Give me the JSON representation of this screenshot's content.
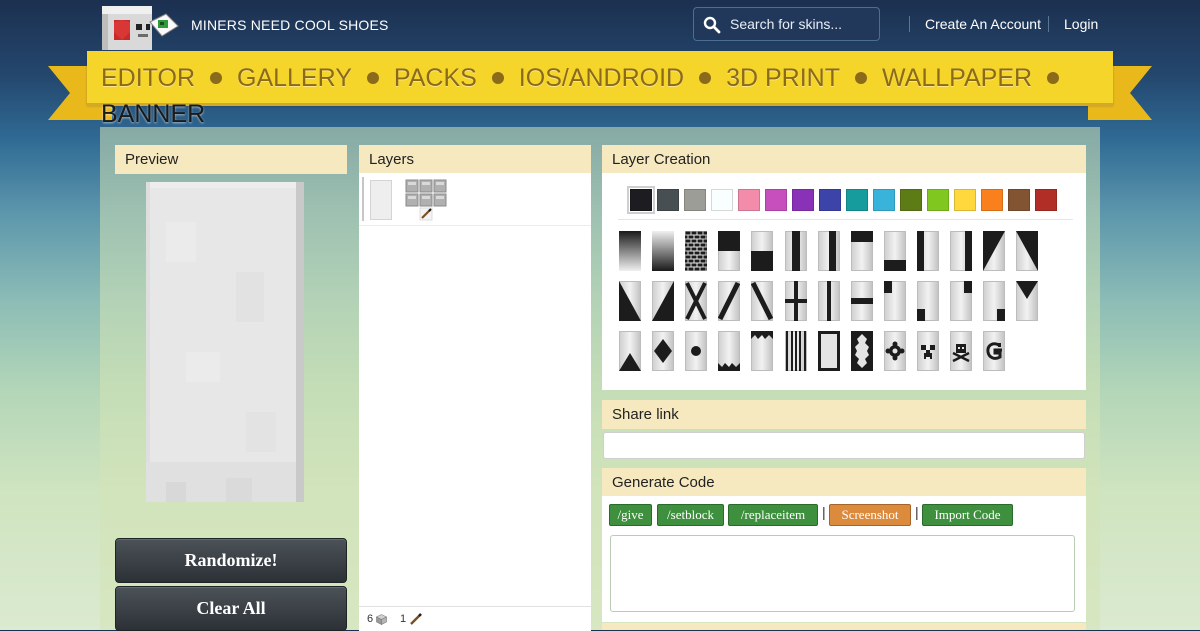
{
  "header": {
    "site_name": "MINERS NEED COOL SHOES",
    "search": {
      "placeholder": "Search for skins..."
    },
    "links": {
      "create_account": "Create An Account",
      "login": "Login"
    }
  },
  "nav": {
    "items": [
      "EDITOR",
      "GALLERY",
      "PACKS",
      "IOS/ANDROID",
      "3D PRINT",
      "WALLPAPER",
      "BANNER"
    ]
  },
  "preview": {
    "title": "Preview",
    "randomize_label": "Randomize!",
    "clear_all_label": "Clear All"
  },
  "layers": {
    "title": "Layers",
    "footer": {
      "block_count": "6",
      "stick_count": "1"
    }
  },
  "layer_creation": {
    "title": "Layer Creation",
    "colors": [
      "#1d1d21",
      "#474f52",
      "#9d9d97",
      "#f9fffe",
      "#f38baa",
      "#c74ebd",
      "#8932b8",
      "#3c44aa",
      "#169c9c",
      "#3ab3da",
      "#5e7c16",
      "#80c71f",
      "#fed83d",
      "#f9801d",
      "#835432",
      "#b02e26"
    ],
    "selected_color": "#1d1d21",
    "patterns": [
      "gradient-icon",
      "gradient-up-icon",
      "bricks-icon",
      "half-top-icon",
      "half-bottom-icon",
      "stripe-center-icon",
      "stripe-left-icon",
      "stripe-top-icon",
      "stripe-bottom-icon",
      "stripe-middle-left-icon",
      "stripe-right-icon",
      "diagonal-left-icon",
      "diagonal-right-icon",
      "diagonal-up-left-icon",
      "diagonal-up-right-icon",
      "cross-icon",
      "stripe-downright-icon",
      "stripe-downleft-icon",
      "straight-cross-icon",
      "stripe-center-thin-icon",
      "stripe-middle-icon",
      "square-top-left-icon",
      "square-bottom-left-icon",
      "square-top-right-icon",
      "square-bottom-right-icon",
      "triangle-top-icon",
      "triangle-bottom-icon",
      "rhombus-icon",
      "circle-icon",
      "triangles-bottom-icon",
      "triangles-top-icon",
      "stripe-small-icon",
      "border-icon",
      "curly-border-icon",
      "flower-icon",
      "creeper-icon",
      "skull-icon",
      "mojang-icon"
    ]
  },
  "share_link": {
    "title": "Share link",
    "value": ""
  },
  "generate_code": {
    "title": "Generate Code",
    "buttons": {
      "give": "/give",
      "setblock": "/setblock",
      "replaceitem": "/replaceitem",
      "screenshot": "Screenshot",
      "import": "Import Code"
    },
    "separator": "|",
    "code": ""
  }
}
